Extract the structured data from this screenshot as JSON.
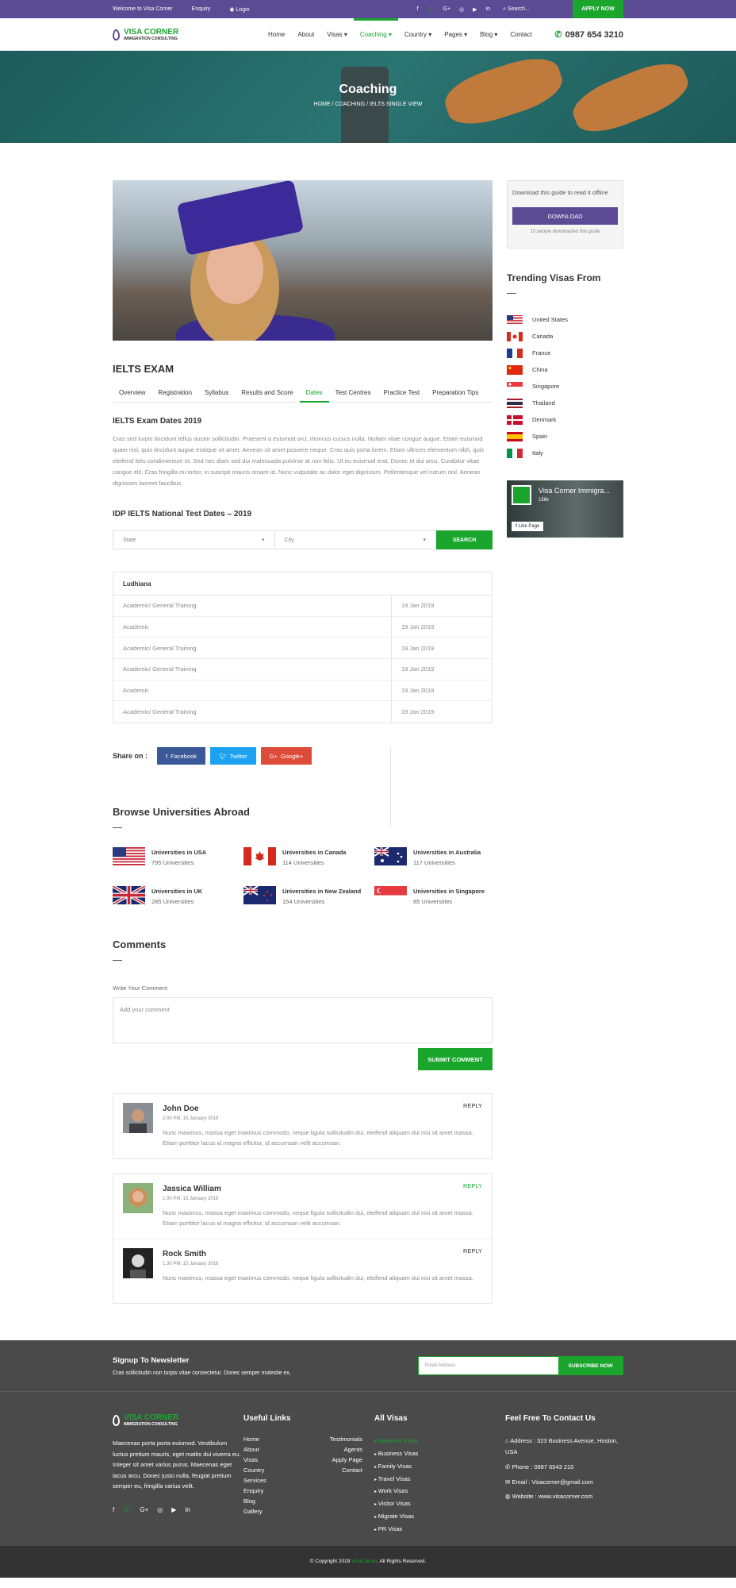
{
  "topbar": {
    "welcome": "Welcome to Visa Corner",
    "enquiry": "Enquiry",
    "login": "Login",
    "search_placeholder": "Search...",
    "apply": "APPLY NOW"
  },
  "header": {
    "brand": "VISA CORNER",
    "tagline": "IMMIGRATION CONSULTING",
    "nav": [
      "Home",
      "About",
      "Visas ▾",
      "Coaching ▾",
      "Country ▾",
      "Pages ▾",
      "Blog ▾",
      "Contact"
    ],
    "phone": "0987 654 3210"
  },
  "banner": {
    "title": "Coaching",
    "breadcrumb": "HOME / COACHING / IELTS SINGLE VIEW"
  },
  "main": {
    "exam_title": "IELTS EXAM",
    "tabs": [
      "Overview",
      "Registration",
      "Syllabus",
      "Results and Score",
      "Dates",
      "Test Centres",
      "Practice Test",
      "Preparation Tips"
    ],
    "dates_title": "IELTS Exam Dates 2019",
    "dates_text": "Cras sed turpis tincidunt tellus auctor sollicitudin. Praesent a euismod orci, rhoncus cursus nulla. Nullam vitae congue augue. Etiam euismod quam nisl, quis tincidunt augue tristique sit amet. Aenean sit amet posuere neque. Cras quis porta lorem. Etiam ultrices elementum nibh, quis eleifend felis condimentum et. Sed nec diam sed dui malesuada pulvinar at non felis. Ut eu euismod erat. Donec et dui arcu. Curabitur vitae congue elit. Cras fringilla mi tortor, in suscipit mauris ornare id. Nunc vulputate ac dolor eget dignissim. Pellentesque vel rutrum nisl. Aenean dignissim laoreet faucibus.",
    "idp_title": "IDP IELTS National Test Dates – 2019",
    "state_placeholder": "State",
    "city_placeholder": "City",
    "search_btn": "SEARCH",
    "table_city": "Ludhiana",
    "table_rows": [
      {
        "type": "Academic/ General Training",
        "date": "19 Jan 2019"
      },
      {
        "type": "Academic",
        "date": "19 Jan 2019"
      },
      {
        "type": "Academic/ General Training",
        "date": "19 Jan 2019"
      },
      {
        "type": "Academic/ General Training",
        "date": "19 Jan 2019"
      },
      {
        "type": "Academic",
        "date": "19 Jan 2019"
      },
      {
        "type": "Academic/ General Training",
        "date": "19 Jan 2019"
      }
    ],
    "share_label": "Share on :",
    "share": {
      "facebook": "Facebook",
      "twitter": "Twitter",
      "google": "Google+"
    },
    "browse_title": "Browse Universities Abroad",
    "universities": [
      {
        "title": "Universities in USA",
        "count": "795 Universities",
        "flag": "us"
      },
      {
        "title": "Universities in Canada",
        "count": "114 Universities",
        "flag": "ca"
      },
      {
        "title": "Universities in Australia",
        "count": "117 Universities",
        "flag": "au"
      },
      {
        "title": "Universities in UK",
        "count": "285 Universities",
        "flag": "uk"
      },
      {
        "title": "Universities in New Zealand",
        "count": "154 Universities",
        "flag": "nz"
      },
      {
        "title": "Universities in Singapore",
        "count": "85 Universities",
        "flag": "sg"
      }
    ],
    "comments_title": "Comments",
    "write_label": "Write Your Comment",
    "comment_placeholder": "Add your comment",
    "submit": "SUBMIT COMMENT",
    "comments": [
      {
        "name": "John Doe",
        "date": "2.00 PM, 15 January 2019",
        "text": "Nunc maximus, massa eget maximus commodo, neque ligula sollicitudin dui, eleifend aliquam dui nisi sit amet massa. Etiam porttitor lacus id magna efficitur, id accumsan velit accumsan.",
        "reply": "REPLY"
      },
      {
        "name": "Jassica William",
        "date": "1.00 PM, 15 January 2019",
        "text": "Nunc maximus, massa eget maximus commodo, neque ligula sollicitudin dui, eleifend aliquam dui nisi sit amet massa. Etiam porttitor lacus id magna efficitur, id accumsan velit accumsan.",
        "reply": "REPLY"
      },
      {
        "name": "Rock Smith",
        "date": "1.30 PM, 15 January 2019",
        "text": "Nunc maximus, massa eget maximus commodo, neque ligula sollicitudin dui, eleifend aliquam dui nisi sit amet massa.",
        "reply": "REPLY"
      }
    ]
  },
  "sidebar": {
    "download_text": "Download this guide to read it offline",
    "download_btn": "DOWNLOAD",
    "download_count": "10 people downloaded this guide",
    "trending_title": "Trending Visas From",
    "countries": [
      "United States",
      "Canada",
      "France",
      "China",
      "Singapore",
      "Thailand",
      "Denmark",
      "Spain",
      "Italy"
    ],
    "fb_name": "Visa Corner Immigra...",
    "fb_likes": "156k",
    "fb_like": "Like Page"
  },
  "newsletter": {
    "title": "Signup To Newsletter",
    "sub": "Cras sollicitudin non turpis vitae consectetur. Donec semper molestie ex,",
    "placeholder": "Email Address",
    "btn": "SUBSCRIBE NOW"
  },
  "footer": {
    "about": "Maecenas porta porta euismod. Vestibulum luctus pretium mauris, eget mattis dui viverra eu. Integer sit amet varius purus. Maecenas eget lacus arcu. Donec justo nulla, feugiat pretium semper eu, fringilla varius velit.",
    "useful_title": "Useful Links",
    "useful": [
      "Home",
      "Testimonials",
      "About",
      "Agents",
      "Visas",
      "Apply Page",
      "Country",
      "Contact",
      "Services",
      "",
      "Enquiry",
      "",
      "Blog",
      "",
      "Gallery",
      ""
    ],
    "visas_title": "All Visas",
    "visas": [
      "Students Visas",
      "Business Visas",
      "Family Visas",
      "Travel Visas",
      "Work Visas",
      "Visitor Visas",
      "Migrate Visas",
      "PR Visas"
    ],
    "contact_title": "Feel Free To Contact Us",
    "address": "Address : 323 Business Avenue, Hoston, USA",
    "phone": "Phone : 0987 6543 210",
    "email": "Email : Visacorner@gmail.com",
    "website": "Website : www.visacorner.com",
    "copyright_pre": "© Copyright 2019",
    "copyright_brand": "VisaCorner",
    "copyright_post": ". All Rights Reserved."
  },
  "colors": {
    "purple": "#5b4a94",
    "green": "#1aa52d",
    "dark": "#4a4a4a"
  }
}
